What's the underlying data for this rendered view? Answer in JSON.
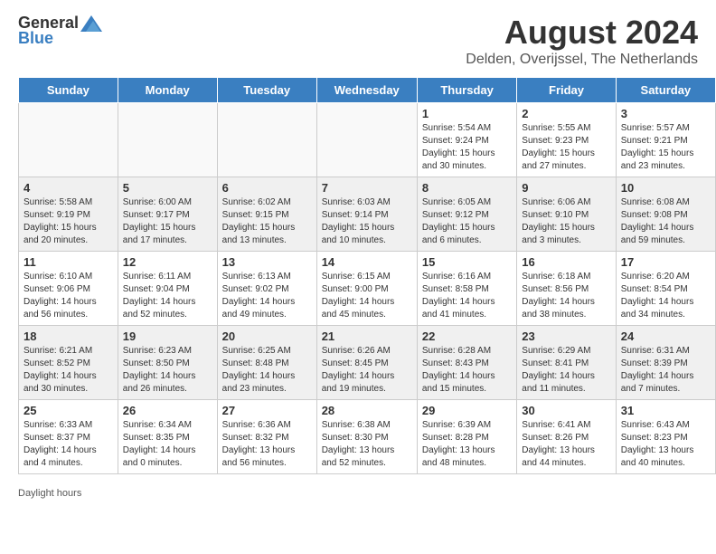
{
  "header": {
    "logo_general": "General",
    "logo_blue": "Blue",
    "month_year": "August 2024",
    "location": "Delden, Overijssel, The Netherlands"
  },
  "days_of_week": [
    "Sunday",
    "Monday",
    "Tuesday",
    "Wednesday",
    "Thursday",
    "Friday",
    "Saturday"
  ],
  "weeks": [
    [
      {
        "day": "",
        "info": ""
      },
      {
        "day": "",
        "info": ""
      },
      {
        "day": "",
        "info": ""
      },
      {
        "day": "",
        "info": ""
      },
      {
        "day": "1",
        "info": "Sunrise: 5:54 AM\nSunset: 9:24 PM\nDaylight: 15 hours\nand 30 minutes."
      },
      {
        "day": "2",
        "info": "Sunrise: 5:55 AM\nSunset: 9:23 PM\nDaylight: 15 hours\nand 27 minutes."
      },
      {
        "day": "3",
        "info": "Sunrise: 5:57 AM\nSunset: 9:21 PM\nDaylight: 15 hours\nand 23 minutes."
      }
    ],
    [
      {
        "day": "4",
        "info": "Sunrise: 5:58 AM\nSunset: 9:19 PM\nDaylight: 15 hours\nand 20 minutes."
      },
      {
        "day": "5",
        "info": "Sunrise: 6:00 AM\nSunset: 9:17 PM\nDaylight: 15 hours\nand 17 minutes."
      },
      {
        "day": "6",
        "info": "Sunrise: 6:02 AM\nSunset: 9:15 PM\nDaylight: 15 hours\nand 13 minutes."
      },
      {
        "day": "7",
        "info": "Sunrise: 6:03 AM\nSunset: 9:14 PM\nDaylight: 15 hours\nand 10 minutes."
      },
      {
        "day": "8",
        "info": "Sunrise: 6:05 AM\nSunset: 9:12 PM\nDaylight: 15 hours\nand 6 minutes."
      },
      {
        "day": "9",
        "info": "Sunrise: 6:06 AM\nSunset: 9:10 PM\nDaylight: 15 hours\nand 3 minutes."
      },
      {
        "day": "10",
        "info": "Sunrise: 6:08 AM\nSunset: 9:08 PM\nDaylight: 14 hours\nand 59 minutes."
      }
    ],
    [
      {
        "day": "11",
        "info": "Sunrise: 6:10 AM\nSunset: 9:06 PM\nDaylight: 14 hours\nand 56 minutes."
      },
      {
        "day": "12",
        "info": "Sunrise: 6:11 AM\nSunset: 9:04 PM\nDaylight: 14 hours\nand 52 minutes."
      },
      {
        "day": "13",
        "info": "Sunrise: 6:13 AM\nSunset: 9:02 PM\nDaylight: 14 hours\nand 49 minutes."
      },
      {
        "day": "14",
        "info": "Sunrise: 6:15 AM\nSunset: 9:00 PM\nDaylight: 14 hours\nand 45 minutes."
      },
      {
        "day": "15",
        "info": "Sunrise: 6:16 AM\nSunset: 8:58 PM\nDaylight: 14 hours\nand 41 minutes."
      },
      {
        "day": "16",
        "info": "Sunrise: 6:18 AM\nSunset: 8:56 PM\nDaylight: 14 hours\nand 38 minutes."
      },
      {
        "day": "17",
        "info": "Sunrise: 6:20 AM\nSunset: 8:54 PM\nDaylight: 14 hours\nand 34 minutes."
      }
    ],
    [
      {
        "day": "18",
        "info": "Sunrise: 6:21 AM\nSunset: 8:52 PM\nDaylight: 14 hours\nand 30 minutes."
      },
      {
        "day": "19",
        "info": "Sunrise: 6:23 AM\nSunset: 8:50 PM\nDaylight: 14 hours\nand 26 minutes."
      },
      {
        "day": "20",
        "info": "Sunrise: 6:25 AM\nSunset: 8:48 PM\nDaylight: 14 hours\nand 23 minutes."
      },
      {
        "day": "21",
        "info": "Sunrise: 6:26 AM\nSunset: 8:45 PM\nDaylight: 14 hours\nand 19 minutes."
      },
      {
        "day": "22",
        "info": "Sunrise: 6:28 AM\nSunset: 8:43 PM\nDaylight: 14 hours\nand 15 minutes."
      },
      {
        "day": "23",
        "info": "Sunrise: 6:29 AM\nSunset: 8:41 PM\nDaylight: 14 hours\nand 11 minutes."
      },
      {
        "day": "24",
        "info": "Sunrise: 6:31 AM\nSunset: 8:39 PM\nDaylight: 14 hours\nand 7 minutes."
      }
    ],
    [
      {
        "day": "25",
        "info": "Sunrise: 6:33 AM\nSunset: 8:37 PM\nDaylight: 14 hours\nand 4 minutes."
      },
      {
        "day": "26",
        "info": "Sunrise: 6:34 AM\nSunset: 8:35 PM\nDaylight: 14 hours\nand 0 minutes."
      },
      {
        "day": "27",
        "info": "Sunrise: 6:36 AM\nSunset: 8:32 PM\nDaylight: 13 hours\nand 56 minutes."
      },
      {
        "day": "28",
        "info": "Sunrise: 6:38 AM\nSunset: 8:30 PM\nDaylight: 13 hours\nand 52 minutes."
      },
      {
        "day": "29",
        "info": "Sunrise: 6:39 AM\nSunset: 8:28 PM\nDaylight: 13 hours\nand 48 minutes."
      },
      {
        "day": "30",
        "info": "Sunrise: 6:41 AM\nSunset: 8:26 PM\nDaylight: 13 hours\nand 44 minutes."
      },
      {
        "day": "31",
        "info": "Sunrise: 6:43 AM\nSunset: 8:23 PM\nDaylight: 13 hours\nand 40 minutes."
      }
    ]
  ],
  "footer": {
    "daylight_label": "Daylight hours"
  }
}
